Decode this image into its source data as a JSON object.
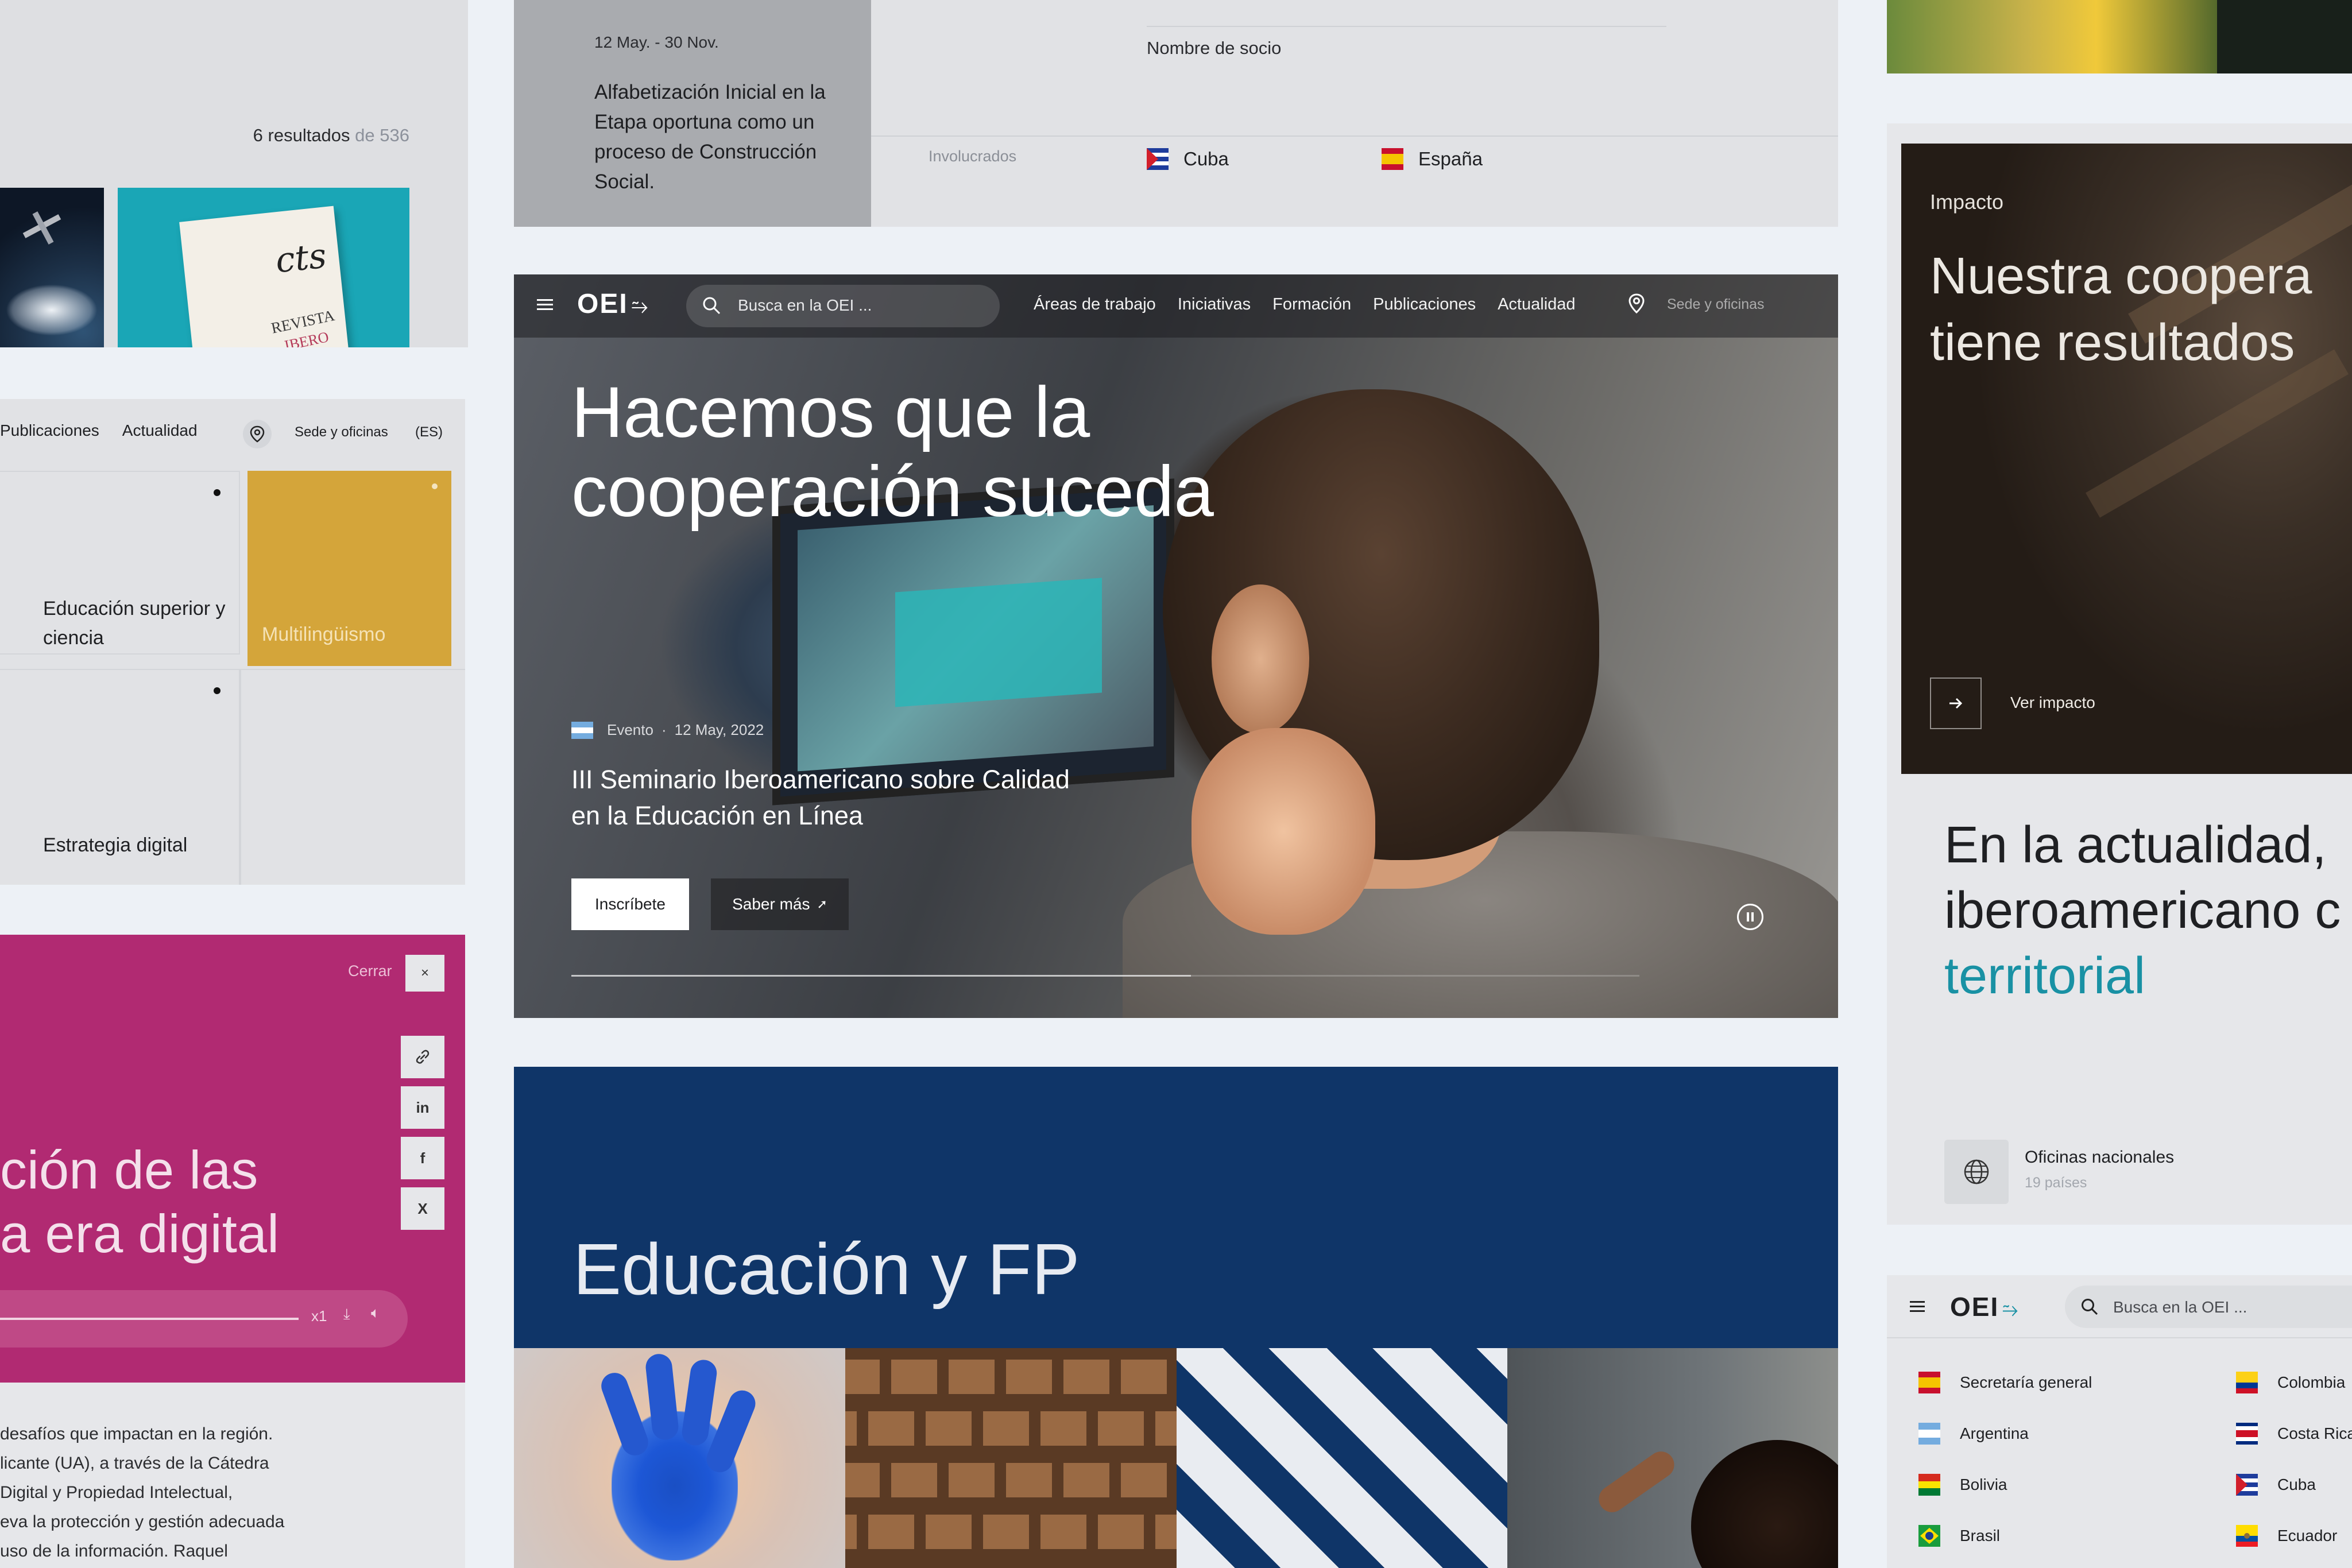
{
  "results": {
    "count_label": "6 resultados",
    "total_label": "de 536"
  },
  "grid_card": {
    "nav": [
      "Publicaciones",
      "Actualidad"
    ],
    "location_label": "Sede y oficinas",
    "language": "(ES)",
    "tiles": [
      "Educación superior y ciencia",
      "Multilingüismo",
      "Estrategia digital"
    ]
  },
  "share_card": {
    "close_label": "Cerrar",
    "close_icon": "×",
    "share_icons": [
      "link-icon",
      "linkedin-icon",
      "facebook-icon",
      "x-icon"
    ],
    "title_line1": "ción de las",
    "title_line2": "a era digital",
    "audio_speed": "x1",
    "text_lines": [
      "desafíos que impactan en la región.",
      "licante (UA), a través de la Cátedra",
      "Digital y Propiedad Intelectual,",
      "eva la protección y gestión adecuada",
      " uso de la información. Raquel"
    ]
  },
  "project": {
    "dates": "12 May. - 30 Nov.",
    "description": "Alfabetización Inicial en la Etapa oportuna como un proceso de Construcción Social.",
    "partner_label": "Nombre de socio",
    "involved_label": "Involucrados",
    "countries": [
      "Cuba",
      "España"
    ]
  },
  "hero": {
    "logo": "OEI",
    "search_placeholder": "Busca en la OEI ...",
    "nav": [
      "Áreas de trabajo",
      "Iniciativas",
      "Formación",
      "Publicaciones",
      "Actualidad"
    ],
    "location_label": "Sede y oficinas",
    "headline": "Hacemos que la cooperación suceda",
    "event_type": "Evento",
    "event_date": "12 May, 2022",
    "event_title": "III Seminario Iberoamericano sobre Calidad en la Educación en Línea",
    "cta_primary": "Inscríbete",
    "cta_secondary": "Saber más",
    "slide_progress": 0.58
  },
  "education": {
    "title": "Educación y FP"
  },
  "impact": {
    "kicker": "Impacto",
    "headline_line1": "Nuestra coopera",
    "headline_line2": "tiene resultados",
    "link_label": "Ver impacto",
    "actualidad_line1": "En la actualidad,",
    "actualidad_line2": "iberoamericano c",
    "actualidad_line3": "territorial",
    "offices_label": "Oficinas nacionales",
    "offices_sub": "19 países"
  },
  "countries_card": {
    "logo": "OEI",
    "search_placeholder": "Busca en la OEI ...",
    "left": [
      "Secretaría general",
      "Argentina",
      "Bolivia",
      "Brasil"
    ],
    "right": [
      "Colombia",
      "Costa Rica",
      "Cuba",
      "Ecuador"
    ]
  },
  "colors": {
    "navy": "#0f3568",
    "magenta": "#b12a72",
    "gold": "#d4a53a",
    "teal": "#1991a4"
  }
}
